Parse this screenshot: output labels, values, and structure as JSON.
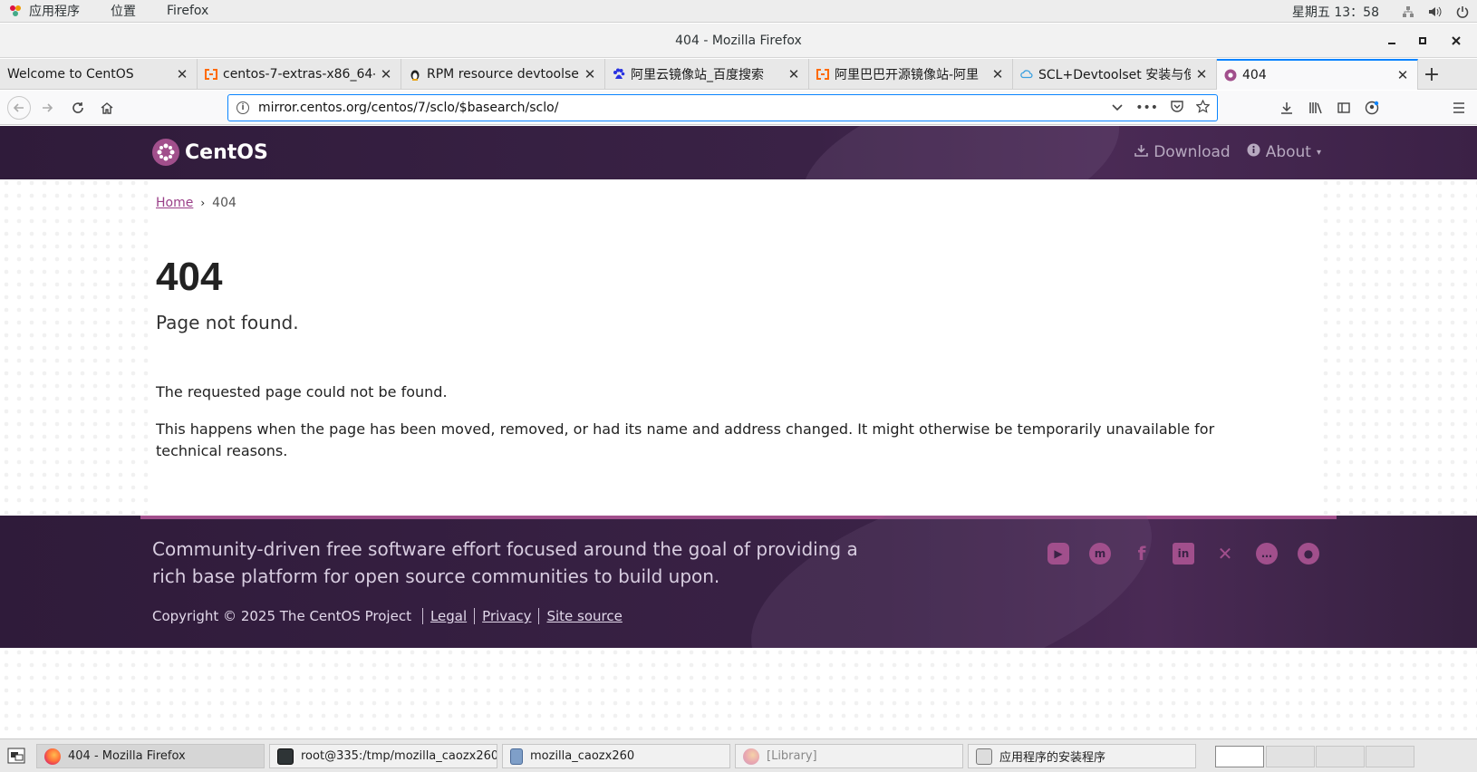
{
  "topbar": {
    "menu": [
      "应用程序",
      "位置",
      "Firefox"
    ],
    "clock": "星期五 13：58",
    "tray_icons": [
      "network-icon",
      "volume-icon",
      "power-icon"
    ]
  },
  "window": {
    "title": "404 - Mozilla Firefox"
  },
  "tabs": [
    {
      "label": "Welcome to CentOS",
      "favicon": "none"
    },
    {
      "label": "centos-7-extras-x86_64-",
      "favicon": "aliyun-icon"
    },
    {
      "label": "RPM resource devtoolset",
      "favicon": "tux-icon"
    },
    {
      "label": "阿里云镜像站_百度搜索",
      "favicon": "baidu-icon"
    },
    {
      "label": "阿里巴巴开源镜像站-阿里",
      "favicon": "aliyun-icon"
    },
    {
      "label": "SCL+Devtoolset 安装与使",
      "favicon": "cloud-icon"
    },
    {
      "label": "404",
      "favicon": "centos-icon"
    }
  ],
  "url": "mirror.centos.org/centos/7/sclo/$basearch/sclo/",
  "site": {
    "brand": "CentOS",
    "nav": {
      "download": "Download",
      "about": "About"
    },
    "breadcrumb": {
      "home": "Home",
      "current": "404"
    },
    "heading": "404",
    "subheading": "Page not found.",
    "paragraph1": "The requested page could not be found.",
    "paragraph2": "This happens when the page has been moved, removed, or had its name and address changed. It might otherwise be temporarily unavailable for technical reasons.",
    "footer": {
      "tagline": "Community-driven free software effort focused around the goal of providing a rich base platform for open source communities to build upon.",
      "copyright": "Copyright © 2025 The CentOS Project",
      "links": [
        "Legal",
        "Privacy",
        "Site source"
      ],
      "socials": [
        "youtube-icon",
        "mastodon-icon",
        "facebook-icon",
        "linkedin-icon",
        "x-icon",
        "chat-icon",
        "reddit-icon"
      ]
    }
  },
  "taskbar": {
    "items": [
      {
        "label": "404 - Mozilla Firefox",
        "state": "active"
      },
      {
        "label": "root@335:/tmp/mozilla_caozx260",
        "state": "normal"
      },
      {
        "label": "mozilla_caozx260",
        "state": "normal"
      },
      {
        "label": "[Library]",
        "state": "dim"
      },
      {
        "label": "应用程序的安装程序",
        "state": "normal"
      }
    ]
  },
  "colors": {
    "accent": "#a14f8c",
    "header_bg": "#3a2246",
    "url_focus": "#0a84ff"
  }
}
